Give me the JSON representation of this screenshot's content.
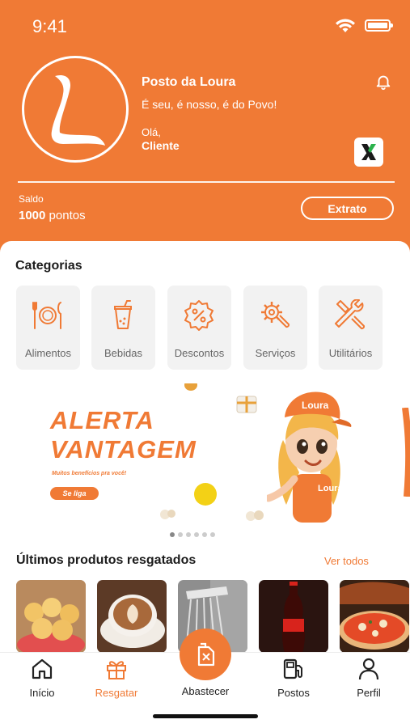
{
  "status_bar": {
    "time": "9:41"
  },
  "header": {
    "store_name": "Posto da Loura",
    "slogan": "É seu, é nosso, é do Povo!",
    "greeting": "Olá,",
    "user_name": "Cliente",
    "logo_icon": "loura-logo",
    "notification_icon": "bell-icon",
    "app_badge_icon": "x-app-icon"
  },
  "balance": {
    "label": "Saldo",
    "amount": "1000",
    "unit": "pontos",
    "statement_button": "Extrato"
  },
  "categories": {
    "title": "Categorias",
    "items": [
      {
        "label": "Alimentos",
        "icon": "plate-cutlery-icon"
      },
      {
        "label": "Bebidas",
        "icon": "drink-cup-icon"
      },
      {
        "label": "Descontos",
        "icon": "discount-badge-icon"
      },
      {
        "label": "Serviços",
        "icon": "gear-wrench-icon"
      },
      {
        "label": "Utilitários",
        "icon": "tools-icon"
      }
    ]
  },
  "banner": {
    "line1": "ALERTA",
    "line2": "VANTAGEM",
    "subtitle": "Muitos benefícios pra você!",
    "cta": "Se liga",
    "mascot_cap_text": "Loura",
    "mascot_shirt_text": "Loura",
    "slide_count": 6,
    "active_slide": 1
  },
  "recent_products": {
    "title": "Últimos produtos resgatados",
    "see_all": "Ver todos",
    "items": [
      {
        "name": "pão de queijo"
      },
      {
        "name": "café"
      },
      {
        "name": "chuveiro"
      },
      {
        "name": "refrigerante"
      },
      {
        "name": "pizza"
      }
    ]
  },
  "bottom_nav": {
    "items": [
      {
        "label": "Início",
        "icon": "home-icon",
        "active": false
      },
      {
        "label": "Resgatar",
        "icon": "gift-icon",
        "active": true
      },
      {
        "label": "Abastecer",
        "icon": "fuel-can-icon",
        "active": false
      },
      {
        "label": "Postos",
        "icon": "gas-pump-icon",
        "active": false
      },
      {
        "label": "Perfil",
        "icon": "user-icon",
        "active": false
      }
    ]
  },
  "colors": {
    "brand": "#F07A35",
    "background": "#ffffff",
    "card": "#f2f2f2"
  }
}
